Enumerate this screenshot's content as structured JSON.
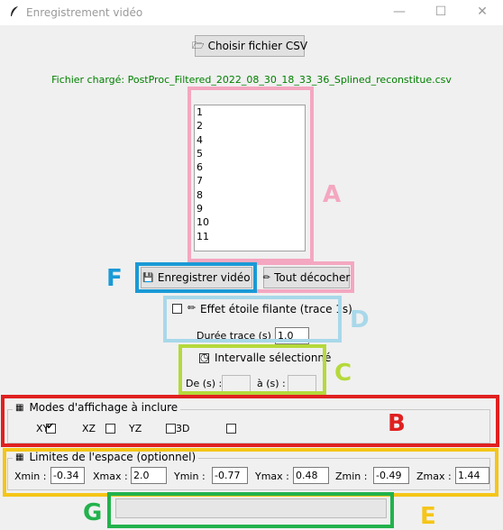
{
  "window": {
    "title": "Enregistrement vidéo"
  },
  "toolbar": {
    "choose_csv_label": "Choisir fichier CSV"
  },
  "file_status": "Fichier chargé: PostProc_Filtered_2022_08_30_18_33_36_Splined_reconstitue.csv",
  "list_items": [
    "1",
    "2",
    "4",
    "5",
    "6",
    "7",
    "8",
    "9",
    "10",
    "11"
  ],
  "buttons": {
    "record_label": "Enregistrer vidéo",
    "uncheck_all_label": "Tout décocher"
  },
  "shooting_star": {
    "label": "Effet étoile filante (trace 1s)",
    "duration_label": "Durée trace (s) :",
    "duration_value": "1.0"
  },
  "interval": {
    "label": "Intervalle sélectionné",
    "from_label": "De (s) :",
    "to_label": "à (s) :"
  },
  "display_modes": {
    "title": "Modes d'affichage à inclure",
    "options": [
      {
        "label": "XY",
        "checked": true
      },
      {
        "label": "XZ",
        "checked": false
      },
      {
        "label": "YZ",
        "checked": false
      },
      {
        "label": "3D",
        "checked": false
      }
    ]
  },
  "limits": {
    "title": "Limites de l'espace (optionnel)",
    "fields": [
      {
        "label": "Xmin :",
        "value": "-0.34"
      },
      {
        "label": "Xmax :",
        "value": "2.0"
      },
      {
        "label": "Ymin :",
        "value": "-0.77"
      },
      {
        "label": "Ymax :",
        "value": "0.48"
      },
      {
        "label": "Zmin :",
        "value": "-0.49"
      },
      {
        "label": "Zmax :",
        "value": "1.44"
      }
    ]
  },
  "annotations": [
    {
      "letter": "A",
      "color": "#f4a7c0"
    },
    {
      "letter": "B",
      "color": "#e02020"
    },
    {
      "letter": "C",
      "color": "#b5d93a"
    },
    {
      "letter": "D",
      "color": "#a8d8ea"
    },
    {
      "letter": "E",
      "color": "#f5c518"
    },
    {
      "letter": "F",
      "color": "#1a9ad6"
    },
    {
      "letter": "G",
      "color": "#22b24c"
    }
  ]
}
